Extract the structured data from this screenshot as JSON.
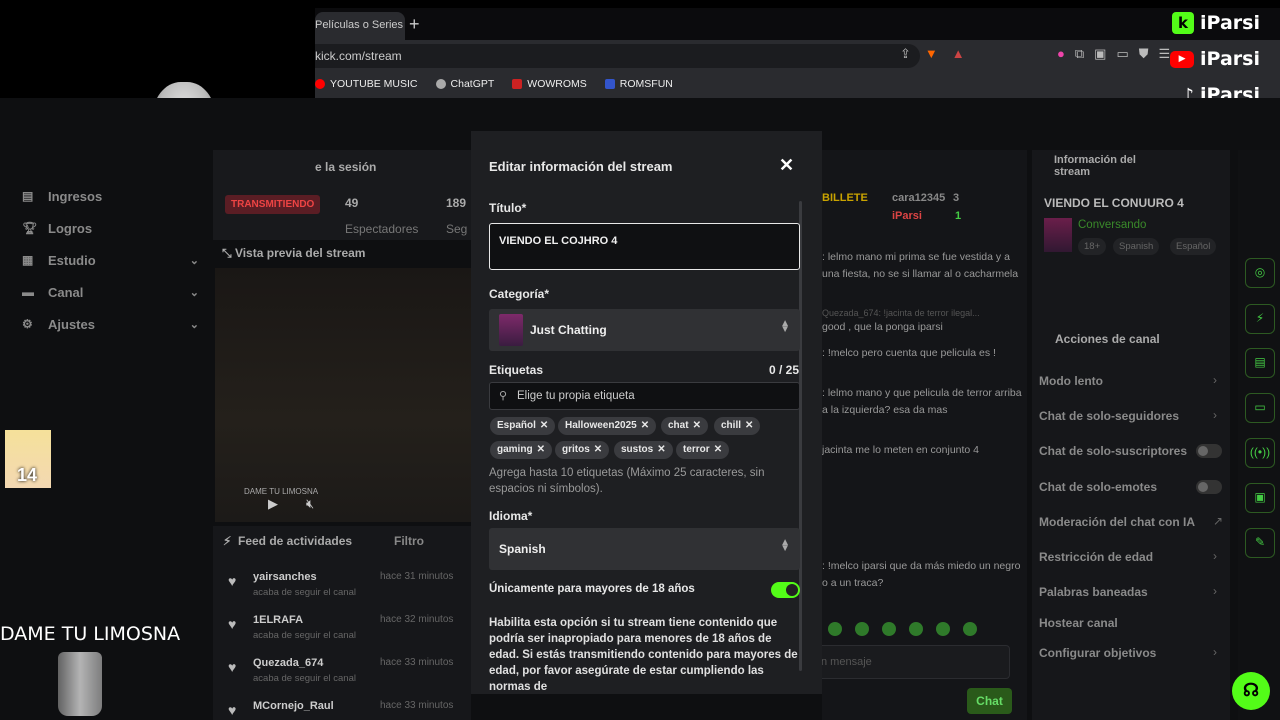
{
  "browser": {
    "tab_title": "Películas o Series C",
    "new_tab": "+",
    "address": "kick.com/stream",
    "bookmarks": [
      "YOUTUBE MUSIC",
      "ChatGPT",
      "WOWROMS",
      "ROMSFUN"
    ]
  },
  "overlay": {
    "brand_kick": "iParsi",
    "brand_youtube": "iParsi",
    "brand_tiktok": "iParsi",
    "dame_text": "DAME TU LIMOSNA",
    "avatar_number": "14"
  },
  "sidebar": {
    "session_title": "e la sesión",
    "items": [
      {
        "label": "Ingresos",
        "icon": "income-icon"
      },
      {
        "label": "Logros",
        "icon": "trophy-icon"
      },
      {
        "label": "Estudio",
        "icon": "studio-icon"
      },
      {
        "label": "Canal",
        "icon": "channel-icon"
      },
      {
        "label": "Ajustes",
        "icon": "settings-icon"
      }
    ]
  },
  "dashboard": {
    "live_badge": "TRANSMITIENDO",
    "viewers": "49",
    "viewers_label": "Espectadores",
    "followers": "189",
    "followers_label": "Seg",
    "session_label": "Sesión",
    "preview_title": "Vista previa del stream",
    "preview_caption": "DAME TU LIMOSNA",
    "feed_title": "Feed de actividades",
    "feed_filter": "Filtro",
    "feed": [
      {
        "user": "yairsanches",
        "time": "hace 31 minutos",
        "action": "acaba de seguir el canal"
      },
      {
        "user": "1ELRAFA",
        "time": "hace 32 minutos",
        "action": "acaba de seguir el canal"
      },
      {
        "user": "Quezada_674",
        "time": "hace 33 minutos",
        "action": "acaba de seguir el canal"
      },
      {
        "user": "MCornejo_Raul",
        "time": "hace 33 minutos",
        "action": ""
      }
    ]
  },
  "chat": {
    "top_left": "BILLETE",
    "top_user1": "cara12345",
    "top_user1_count": "3",
    "top_user2": "iParsi",
    "top_user2_count": "1",
    "lines": [
      ": lelmo mano mi prima se fue vestida y a una fiesta, no se si llamar al o cacharmela",
      "Quezada_674: !jacinta de terror ilegal...",
      " good , que la ponga iparsi",
      ": !melco pero cuenta que pelicula es !",
      ": lelmo mano y que pelicula de terror arriba a la izquierda? esa da mas",
      "jacinta me lo meten en conjunto 4",
      ": !melco iparsi que da más miedo un negro o a un traca?"
    ],
    "input_placeholder": "n mensaje",
    "send_label": "Chat"
  },
  "right_panel": {
    "info_title": "Información del stream",
    "stream_title": "VIENDO EL CONUURO 4",
    "category": "Conversando",
    "tags": [
      "18+",
      "Spanish",
      "Español"
    ],
    "actions_title": "Acciones de canal",
    "actions": [
      {
        "label": "Modo lento",
        "kind": "chevron"
      },
      {
        "label": "Chat de solo-seguidores",
        "kind": "chevron"
      },
      {
        "label": "Chat de solo-suscriptores",
        "kind": "toggle"
      },
      {
        "label": "Chat de solo-emotes",
        "kind": "toggle"
      },
      {
        "label": "Moderación del chat con IA",
        "kind": "link"
      },
      {
        "label": "Restricción de edad",
        "kind": "chevron"
      },
      {
        "label": "Palabras baneadas",
        "kind": "chevron"
      },
      {
        "label": "Hostear canal",
        "kind": "none"
      },
      {
        "label": "Configurar objetivos",
        "kind": "chevron"
      }
    ]
  },
  "modal": {
    "title": "Editar información del stream",
    "close": "✕",
    "title_label": "Título*",
    "title_value": "VIENDO EL COJHRO 4",
    "category_label": "Categoría*",
    "category_value": "Just Chatting",
    "tags_label": "Etiquetas",
    "tags_count": "0 / 25",
    "tag_placeholder": "Elige tu propia etiqueta",
    "tags": [
      "Español",
      "Halloween2025",
      "chat",
      "chill",
      "gaming",
      "gritos",
      "sustos",
      "terror"
    ],
    "tags_help": "Agrega hasta 10 etiquetas (Máximo 25 caracteres, sin espacios ni símbolos).",
    "language_label": "Idioma*",
    "language_value": "Spanish",
    "adult_label": "Únicamente para mayores de 18 años",
    "adult_enabled": true,
    "adult_desc": "Habilita esta opción si tu stream tiene contenido que podría ser inapropiado para menores de 18 años de edad. Si estás transmitiendo contenido para mayores de edad, por favor asegúrate de estar cumpliendo las normas de"
  },
  "colors": {
    "accent": "#53fc18",
    "modal_bg": "#1e1f22",
    "page_bg": "#0e0f11"
  }
}
